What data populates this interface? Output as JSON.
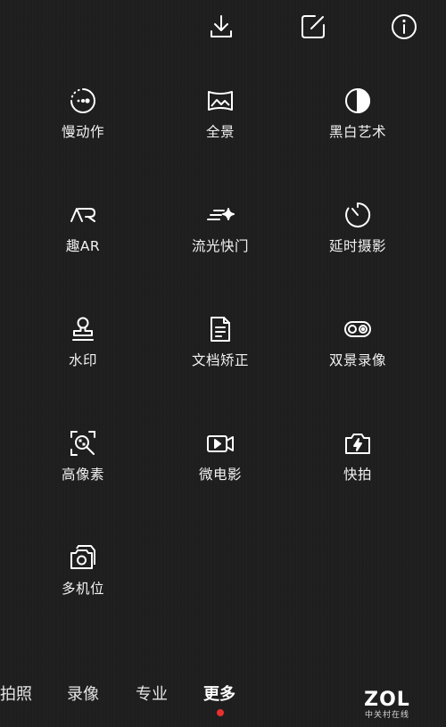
{
  "top_icons": [
    "download-icon",
    "edit-icon",
    "info-icon"
  ],
  "modes": [
    {
      "label": "慢动作",
      "icon": "slow-motion-icon"
    },
    {
      "label": "全景",
      "icon": "panorama-icon"
    },
    {
      "label": "黑白艺术",
      "icon": "monochrome-icon"
    },
    {
      "label": "趣AR",
      "icon": "ar-icon"
    },
    {
      "label": "流光快门",
      "icon": "light-painting-icon"
    },
    {
      "label": "延时摄影",
      "icon": "time-lapse-icon"
    },
    {
      "label": "水印",
      "icon": "watermark-stamp-icon"
    },
    {
      "label": "文档矫正",
      "icon": "document-icon"
    },
    {
      "label": "双景录像",
      "icon": "dual-view-icon"
    },
    {
      "label": "高像素",
      "icon": "high-resolution-icon"
    },
    {
      "label": "微电影",
      "icon": "movie-camera-icon"
    },
    {
      "label": "快拍",
      "icon": "quick-snap-icon"
    },
    {
      "label": "多机位",
      "icon": "multi-camera-icon"
    }
  ],
  "bottom_tabs": [
    {
      "label": "拍照",
      "active": false
    },
    {
      "label": "录像",
      "active": false
    },
    {
      "label": "专业",
      "active": false
    },
    {
      "label": "更多",
      "active": true
    }
  ],
  "active_indicator_color": "#e8302f",
  "watermark": {
    "main": "ZOL",
    "sub": "中关村在线"
  }
}
